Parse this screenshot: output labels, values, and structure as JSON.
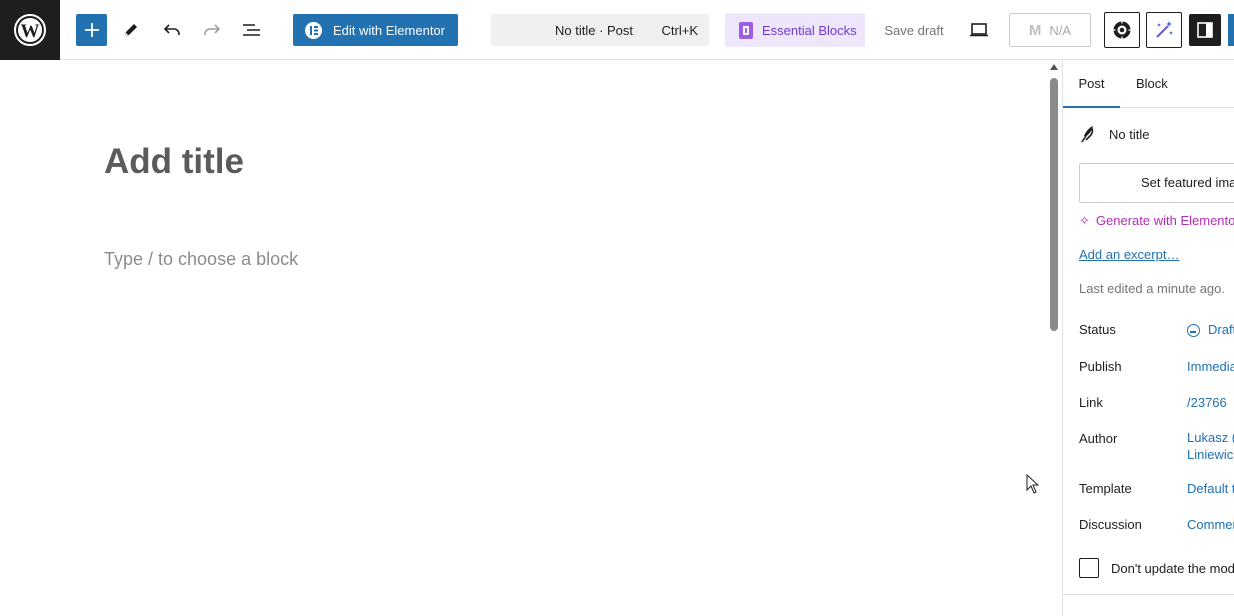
{
  "toolbar": {
    "edit_with_elementor": "Edit with Elementor",
    "command_title": "No title · Post",
    "command_shortcut": "Ctrl+K",
    "essential_blocks": "Essential Blocks",
    "save_draft": "Save draft",
    "na_label": "N/A"
  },
  "editor": {
    "title_placeholder": "Add title",
    "block_placeholder": "Type / to choose a block"
  },
  "sidebar": {
    "tabs": [
      "Post",
      "Block"
    ],
    "post_title": "No title",
    "featured_image": "Set featured image",
    "generate": "Generate with Elementor",
    "excerpt": "Add an excerpt…",
    "last_edited": "Last edited a minute ago.",
    "rows": [
      {
        "label": "Status",
        "value": "Draft"
      },
      {
        "label": "Publish",
        "value": "Immediately"
      },
      {
        "label": "Link",
        "value": "/23766"
      },
      {
        "label": "Author",
        "value": "Lukasz (L",
        "value2": "Liniewicz"
      },
      {
        "label": "Template",
        "value": "Default template"
      },
      {
        "label": "Discussion",
        "value": "Comments"
      }
    ],
    "dont_update": "Don't update the modified date"
  },
  "colors": {
    "accent": "#2271b1",
    "dark": "#1e1e1e",
    "elementor_pink": "#b22fb2",
    "essential_purple": "#6e3ad3"
  }
}
